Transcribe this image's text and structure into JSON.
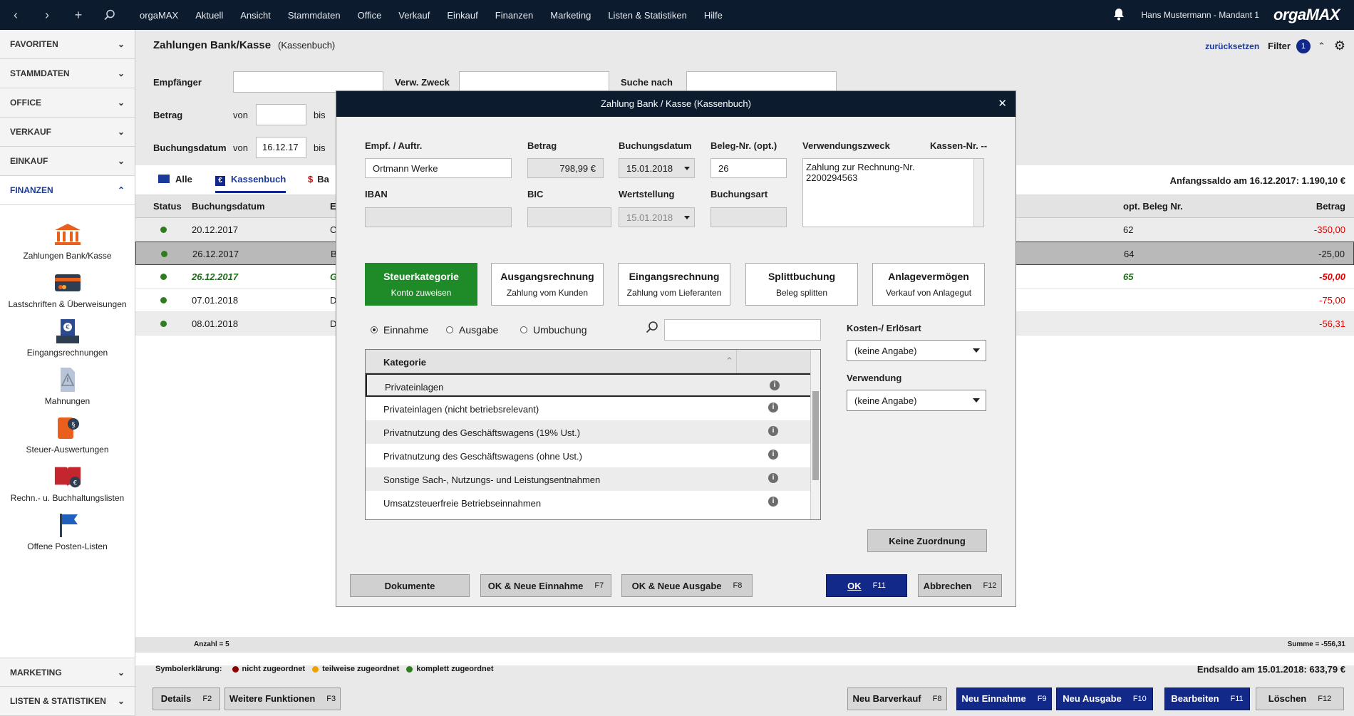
{
  "topbar": {
    "menu": [
      "orgaMAX",
      "Aktuell",
      "Ansicht",
      "Stammdaten",
      "Office",
      "Verkauf",
      "Einkauf",
      "Finanzen",
      "Marketing",
      "Listen & Statistiken",
      "Hilfe"
    ],
    "user": "Hans Mustermann - Mandant 1",
    "logo": "orgaMAX"
  },
  "sidebar": {
    "sections": [
      "FAVORITEN",
      "STAMMDATEN",
      "OFFICE",
      "VERKAUF",
      "EINKAUF",
      "FINANZEN"
    ],
    "active": "FINANZEN",
    "items": [
      "Zahlungen Bank/Kasse",
      "Lastschriften & Überweisungen",
      "Eingangsrechnungen",
      "Mahnungen",
      "Steuer-Auswertungen",
      "Rechn.- u. Buchhaltungslisten",
      "Offene Posten-Listen"
    ],
    "bottom": [
      "MARKETING",
      "LISTEN & STATISTIKEN"
    ]
  },
  "header": {
    "title": "Zahlungen Bank/Kasse",
    "subtitle": "(Kassenbuch)",
    "reset": "zurücksetzen",
    "filter": "Filter",
    "filter_count": "1"
  },
  "filters": {
    "empfaenger": "Empfänger",
    "verw_zweck": "Verw. Zweck",
    "suche_nach": "Suche nach",
    "betrag": "Betrag",
    "von": "von",
    "bis": "bis",
    "buchungsdatum": "Buchungsdatum",
    "buchungsdatum_von": "16.12.17"
  },
  "tabs": [
    "Alle",
    "Kassenbuch",
    "Ba"
  ],
  "anfangssaldo": "Anfangssaldo am 16.12.2017: 1.190,10 €",
  "grid": {
    "columns": [
      "Status",
      "Buchungsdatum",
      "E",
      "opt. Beleg Nr.",
      "Betrag"
    ],
    "rows": [
      {
        "date": "20.12.2017",
        "e": "C",
        "beleg": "62",
        "betrag": "-350,00"
      },
      {
        "date": "26.12.2017",
        "e": "B",
        "beleg": "64",
        "betrag": "-25,00"
      },
      {
        "date": "26.12.2017",
        "e": "G",
        "beleg": "65",
        "betrag": "-50,00"
      },
      {
        "date": "07.01.2018",
        "e": "D",
        "beleg": "",
        "betrag": "-75,00"
      },
      {
        "date": "08.01.2018",
        "e": "D",
        "beleg": "",
        "betrag": "-56,31"
      }
    ]
  },
  "summary": {
    "anzahl": "Anzahl = 5",
    "summe": "Summe = -556,31"
  },
  "legend": {
    "label": "Symbolerklärung:",
    "items": [
      "nicht zugeordnet",
      "teilweise zugeordnet",
      "komplett zugeordnet"
    ],
    "endsaldo": "Endsaldo am 15.01.2018: 633,79 €"
  },
  "actions": {
    "left": [
      {
        "label": "Details",
        "key": "F2"
      },
      {
        "label": "Weitere Funktionen",
        "key": "F3"
      }
    ],
    "right": [
      {
        "label": "Neu Barverkauf",
        "key": "F8"
      },
      {
        "label": "Neu Einnahme",
        "key": "F9"
      },
      {
        "label": "Neu Ausgabe",
        "key": "F10"
      },
      {
        "label": "Bearbeiten",
        "key": "F11"
      },
      {
        "label": "Löschen",
        "key": "F12"
      }
    ]
  },
  "dialog": {
    "title": "Zahlung Bank / Kasse (Kassenbuch)",
    "labels": {
      "empf": "Empf. / Auftr.",
      "betrag": "Betrag",
      "buchungsdatum": "Buchungsdatum",
      "beleg": "Beleg-Nr. (opt.)",
      "verwendungszweck": "Verwendungszweck",
      "kassen": "Kassen-Nr. --",
      "iban": "IBAN",
      "bic": "BIC",
      "wertstellung": "Wertstellung",
      "buchungsart": "Buchungsart"
    },
    "values": {
      "empf": "Ortmann Werke",
      "betrag": "798,99 €",
      "buchungsdatum": "15.01.2018",
      "beleg": "26",
      "verwendungszweck": "Zahlung zur Rechnung-Nr. 2200294563",
      "wertstellung": "15.01.2018"
    },
    "categories": [
      {
        "title": "Steuerkategorie",
        "sub": "Konto zuweisen"
      },
      {
        "title": "Ausgangsrechnung",
        "sub": "Zahlung vom Kunden"
      },
      {
        "title": "Eingangsrechnung",
        "sub": "Zahlung vom Lieferanten"
      },
      {
        "title": "Splittbuchung",
        "sub": "Beleg splitten"
      },
      {
        "title": "Anlagevermögen",
        "sub": "Verkauf von Anlagegut"
      }
    ],
    "radios": [
      "Einnahme",
      "Ausgabe",
      "Umbuchung"
    ],
    "kategorie_header": "Kategorie",
    "kategorien": [
      "Privateinlagen",
      "Privateinlagen  (nicht betriebsrelevant)",
      "Privatnutzung des Geschäftswagens (19% Ust.)",
      "Privatnutzung des Geschäftswagens (ohne Ust.)",
      "Sonstige Sach-, Nutzungs- und Leistungsentnahmen",
      "Umsatzsteuerfreie Betriebseinnahmen"
    ],
    "kosten_label": "Kosten-/ Erlösart",
    "kosten_value": "(keine Angabe)",
    "verwendung_label": "Verwendung",
    "verwendung_value": "(keine Angabe)",
    "keine_zuordnung": "Keine Zuordnung",
    "buttons": {
      "dokumente": "Dokumente",
      "ok_einnahme": "OK & Neue Einnahme",
      "ok_einnahme_key": "F7",
      "ok_ausgabe": "OK & Neue Ausgabe",
      "ok_ausgabe_key": "F8",
      "ok": "OK",
      "ok_key": "F11",
      "abbrechen": "Abbrechen",
      "abbrechen_key": "F12"
    }
  }
}
